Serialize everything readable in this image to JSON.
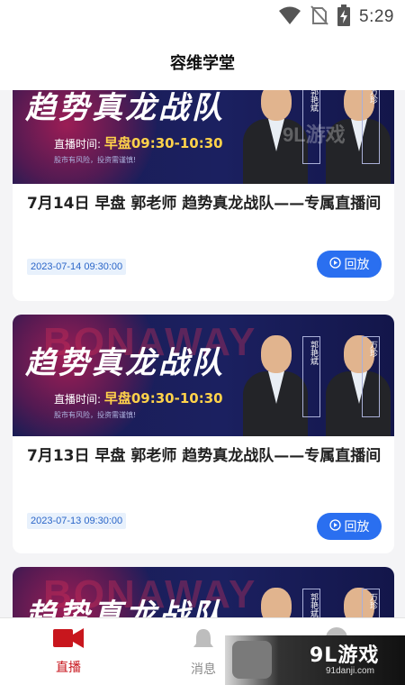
{
  "status_bar": {
    "time": "5:29"
  },
  "header": {
    "title": "容维学堂"
  },
  "feed": {
    "cards": [
      {
        "banner_title": "趋势真龙战队",
        "banner_time_label": "直播时间:",
        "banner_time_value": "早盘09:30-10:30",
        "banner_warning": "股市有风险，投资需谨慎!",
        "teacher_1": "郭艳斌",
        "teacher_2": "万珍",
        "title": "7月14日 早盘 郭老师 趋势真龙战队——专属直播间",
        "date": "2023-07-14 09:30:00",
        "replay_label": "回放"
      },
      {
        "banner_ghost": "BONAWAY",
        "banner_title": "趋势真龙战队",
        "banner_time_label": "直播时间:",
        "banner_time_value": "早盘09:30-10:30",
        "banner_warning": "股市有风险，投资需谨慎!",
        "teacher_1": "郭艳斌",
        "teacher_2": "万珍",
        "title": "7月13日 早盘 郭老师 趋势真龙战队——专属直播间",
        "date": "2023-07-13 09:30:00",
        "replay_label": "回放"
      },
      {
        "banner_ghost": "BONAWAY",
        "banner_title": "趋势真龙战队",
        "teacher_1": "郭艳斌",
        "teacher_2": "万珍"
      }
    ]
  },
  "tabbar": {
    "live_label": "直播",
    "messages_label": "消息"
  },
  "overlay": {
    "brand": "9L游戏",
    "url": "91danji.com",
    "banner_watermark": "9L游戏"
  },
  "colors": {
    "accent": "#c8161d",
    "button_blue": "#2a6ff0",
    "banner_navy": "#1b2060"
  }
}
